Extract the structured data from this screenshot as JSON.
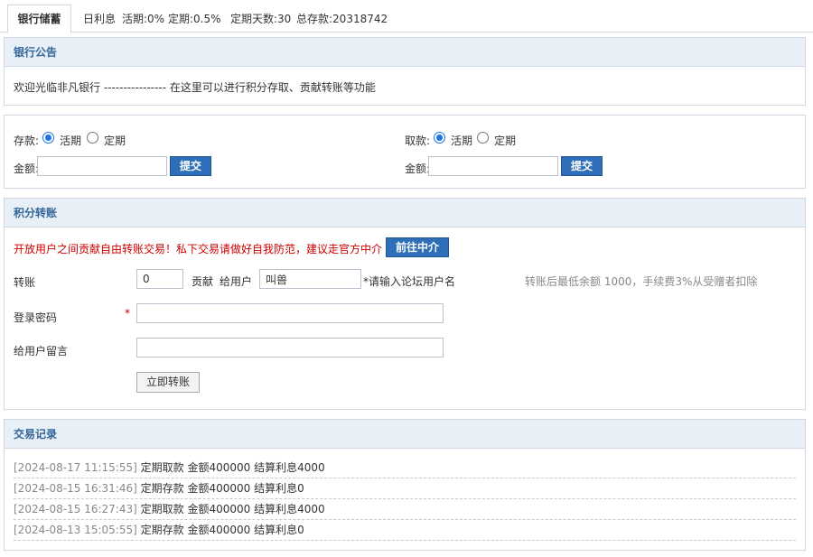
{
  "tabs": {
    "active_label": "银行储蓄",
    "daily_interest_label": "日利息",
    "current_rate": "活期:0%",
    "fixed_rate": "定期:0.5%",
    "fixed_days": "定期天数:30",
    "total_deposit": "总存款:20318742"
  },
  "notice": {
    "title": "银行公告",
    "text": "欢迎光临非凡银行 ---------------- 在这里可以进行积分存取、贡献转账等功能"
  },
  "deposit": {
    "label": "存款:",
    "option_current": "活期",
    "option_fixed": "定期",
    "selected": "活期",
    "amount_label": "金额:",
    "amount_value": "",
    "submit_label": "提交"
  },
  "withdraw": {
    "label": "取款:",
    "option_current": "活期",
    "option_fixed": "定期",
    "selected": "活期",
    "amount_label": "金额:",
    "amount_value": "",
    "submit_label": "提交"
  },
  "transfer": {
    "title": "积分转账",
    "warning": "开放用户之间贡献自由转账交易！私下交易请做好自我防范，建议走官方中介",
    "agent_button": "前往中介",
    "transfer_label": "转账",
    "amount_value": "0",
    "currency_label": "贡献",
    "to_user_label": "给用户",
    "to_user_value": "叫兽",
    "to_user_hint": "*请输入论坛用户名",
    "fee_note": "转账后最低余额 1000，手续费3%从受赠者扣除",
    "password_label": "登录密码",
    "required_mark": "*",
    "password_value": "",
    "message_label": "给用户留言",
    "message_value": "",
    "submit_label": "立即转账"
  },
  "records": {
    "title": "交易记录",
    "rows": [
      {
        "time": "[2024-08-17 11:15:55]",
        "text": "定期取款 金额400000 结算利息4000"
      },
      {
        "time": "[2024-08-15 16:31:46]",
        "text": "定期存款 金额400000 结算利息0"
      },
      {
        "time": "[2024-08-15 16:27:43]",
        "text": "定期取款 金额400000 结算利息4000"
      },
      {
        "time": "[2024-08-13 15:05:55]",
        "text": "定期存款 金额400000 结算利息0"
      }
    ]
  },
  "colors": {
    "accent_blue": "#2e6fb7",
    "panel_header_bg": "#e8eff7",
    "panel_title": "#336699",
    "warning_red": "#cc0000",
    "hint_red": "#cc0000",
    "muted_gray": "#888888"
  }
}
